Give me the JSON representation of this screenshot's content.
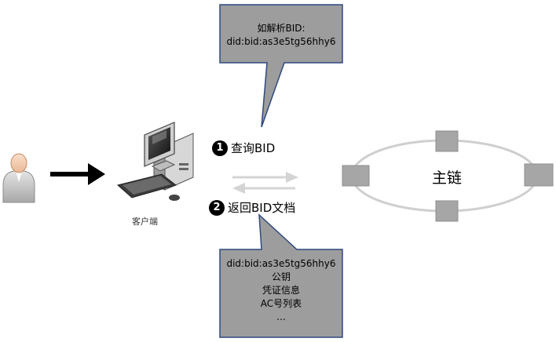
{
  "callout_top": {
    "line1": "如解析BID:",
    "line2": "did:bid:as3e5tg56hhy6"
  },
  "callout_bottom": {
    "line1": "did:bid:as3e5tg56hhy6",
    "line2": "公钥",
    "line3": "凭证信息",
    "line4": "AC号列表",
    "line5": "..."
  },
  "steps": [
    {
      "num": "1",
      "label": "查询BID"
    },
    {
      "num": "2",
      "label": "返回BID文档"
    }
  ],
  "client": {
    "label": "客户端"
  },
  "chain": {
    "label": "主链"
  },
  "icons": [
    "user-icon",
    "right-arrow-icon",
    "computer-icon"
  ],
  "colors": {
    "callout_fill": "#9d9d9d",
    "callout_border": "#2f4a7e",
    "node_fill": "#a6a6a6",
    "chain_ring": "#cfcfcf"
  }
}
